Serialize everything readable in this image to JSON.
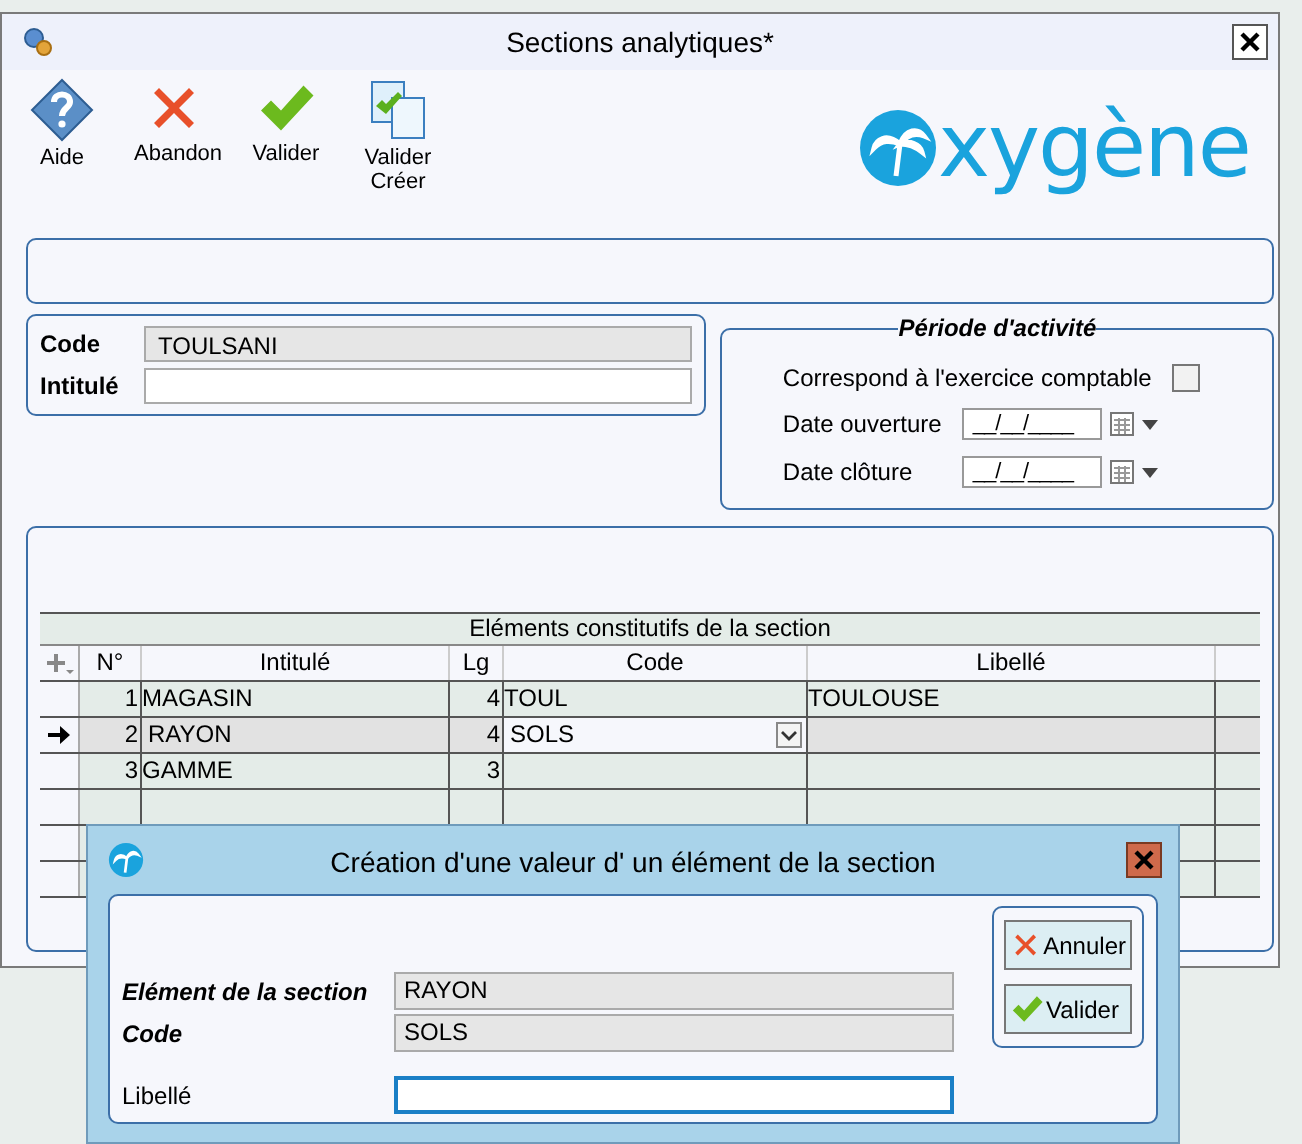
{
  "window": {
    "title": "Sections analytiques*"
  },
  "toolbar": [
    {
      "kind": "help",
      "label": "Aide"
    },
    {
      "kind": "cancel",
      "label": "Abandon"
    },
    {
      "kind": "ok",
      "label": "Valider"
    },
    {
      "kind": "okcreate",
      "label": "Valider Créer"
    }
  ],
  "logo": {
    "text": "xygène"
  },
  "section": {
    "code_label": "Code",
    "code_value": "TOULSANI",
    "intitule_label": "Intitulé"
  },
  "period": {
    "title": "Période d'activité",
    "fiscal_label": "Correspond à l'exercice comptable",
    "fiscal_checked": false,
    "open_label": "Date ouverture",
    "open_value": "__/__/____",
    "close_label": "Date clôture",
    "close_value": "__/__/____"
  },
  "table": {
    "caption": "Eléments constitutifs de la section",
    "columns": [
      "N°",
      "Intitulé",
      "Lg",
      "Code",
      "Libellé"
    ],
    "rows": [
      {
        "n": "1",
        "intitule": "MAGASIN",
        "lg": "4",
        "code": "TOUL",
        "libelle": "TOULOUSE",
        "selected": false
      },
      {
        "n": "2",
        "intitule": "RAYON",
        "lg": "4",
        "code": "SOLS",
        "libelle": "",
        "selected": true
      },
      {
        "n": "3",
        "intitule": "GAMME",
        "lg": "3",
        "code": "",
        "libelle": "",
        "selected": false
      },
      {
        "n": "",
        "intitule": "",
        "lg": "",
        "code": "",
        "libelle": "",
        "selected": false
      },
      {
        "n": "",
        "intitule": "",
        "lg": "",
        "code": "",
        "libelle": "",
        "selected": false
      },
      {
        "n": "",
        "intitule": "",
        "lg": "",
        "code": "",
        "libelle": "",
        "selected": false
      }
    ]
  },
  "dialog": {
    "title": "Création d'une valeur d' un élément de la section",
    "element_label": "Elément de la section",
    "element_value": "RAYON",
    "code_label": "Code",
    "code_value": "SOLS",
    "libelle_label": "Libellé",
    "buttons": [
      {
        "kind": "cancel",
        "label": "Annuler"
      },
      {
        "kind": "ok",
        "label": "Valider"
      }
    ]
  }
}
